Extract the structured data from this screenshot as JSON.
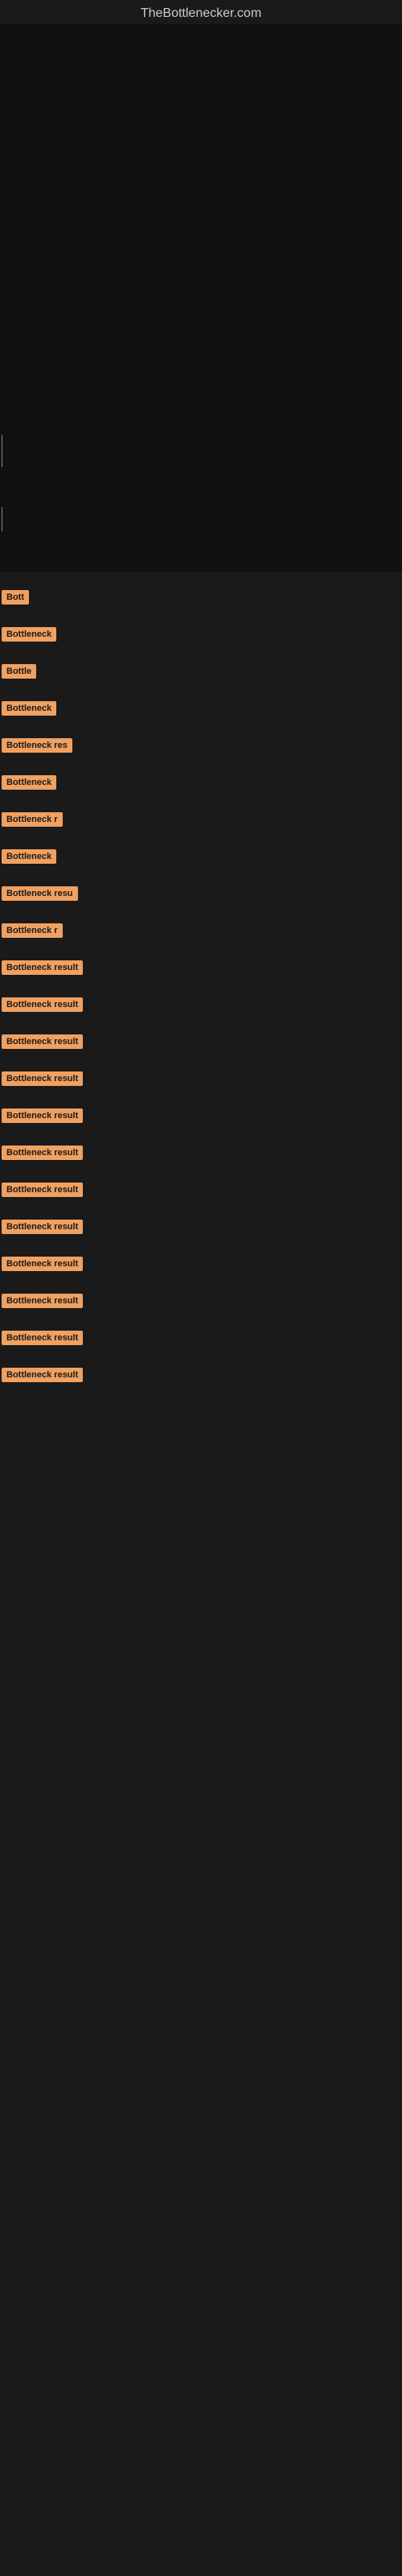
{
  "site": {
    "title": "TheBottlenecker.com"
  },
  "results": [
    {
      "id": 1,
      "label": "Bott",
      "size": "xs"
    },
    {
      "id": 2,
      "label": "Bottleneck",
      "size": "sm"
    },
    {
      "id": 3,
      "label": "Bottle",
      "size": "xs2"
    },
    {
      "id": 4,
      "label": "Bottleneck",
      "size": "sm"
    },
    {
      "id": 5,
      "label": "Bottleneck res",
      "size": "md"
    },
    {
      "id": 6,
      "label": "Bottleneck",
      "size": "sm"
    },
    {
      "id": 7,
      "label": "Bottleneck r",
      "size": "sm2"
    },
    {
      "id": 8,
      "label": "Bottleneck",
      "size": "sm"
    },
    {
      "id": 9,
      "label": "Bottleneck resu",
      "size": "md2"
    },
    {
      "id": 10,
      "label": "Bottleneck r",
      "size": "sm2"
    },
    {
      "id": 11,
      "label": "Bottleneck result",
      "size": "full"
    },
    {
      "id": 12,
      "label": "Bottleneck result",
      "size": "full"
    },
    {
      "id": 13,
      "label": "Bottleneck result",
      "size": "full"
    },
    {
      "id": 14,
      "label": "Bottleneck result",
      "size": "full"
    },
    {
      "id": 15,
      "label": "Bottleneck result",
      "size": "full"
    },
    {
      "id": 16,
      "label": "Bottleneck result",
      "size": "full"
    },
    {
      "id": 17,
      "label": "Bottleneck result",
      "size": "full"
    },
    {
      "id": 18,
      "label": "Bottleneck result",
      "size": "full"
    },
    {
      "id": 19,
      "label": "Bottleneck result",
      "size": "full"
    },
    {
      "id": 20,
      "label": "Bottleneck result",
      "size": "full"
    },
    {
      "id": 21,
      "label": "Bottleneck result",
      "size": "full"
    },
    {
      "id": 22,
      "label": "Bottleneck result",
      "size": "full"
    }
  ],
  "colors": {
    "background": "#1a1a1a",
    "chart_bg": "#111111",
    "badge_bg": "#f0a060",
    "badge_text": "#1a1a1a",
    "site_title": "#cccccc"
  }
}
